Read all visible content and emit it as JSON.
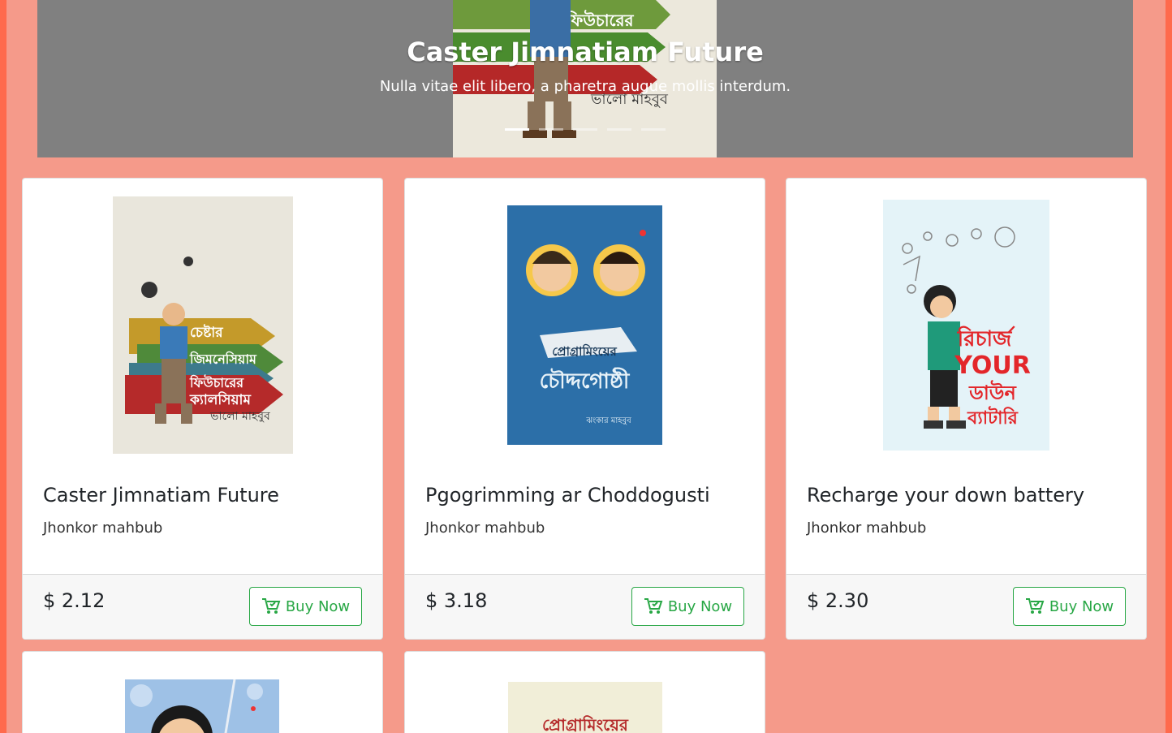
{
  "carousel": {
    "title": "Caster Jimnatiam Future",
    "text": "Nulla vitae elit libero, a pharetra augue mollis interdum.",
    "indicators": 5,
    "active_index": 0
  },
  "currency_symbol": "$",
  "buy_label": "Buy Now",
  "colors": {
    "page_bg": "#f59a8a",
    "accent": "#28a745"
  },
  "products": [
    {
      "title": "Caster Jimnatiam Future",
      "author": "Jhonkor mahbub",
      "price": "$ 2.12",
      "cover_text": [
        "চেষ্টার",
        "জিমনেসিয়াম",
        "ফিউচারের",
        "ক্যালসিয়াম"
      ]
    },
    {
      "title": "Pgogrimming ar Choddogusti",
      "author": "Jhonkor mahbub",
      "price": "$ 3.18",
      "cover_text": [
        "প্রোগ্রামিংয়ের",
        "চৌদ্দগোষ্ঠী"
      ]
    },
    {
      "title": "Recharge your down battery",
      "author": "Jhonkor mahbub",
      "price": "$ 2.30",
      "cover_text": [
        "রিচার্জ",
        "YOUR",
        "ডাউন",
        "ব্যাটারি"
      ]
    }
  ],
  "partial_products": [
    {
      "cover_text": []
    },
    {
      "cover_text": [
        "প্রোগ্রামিংয়ের"
      ]
    }
  ]
}
